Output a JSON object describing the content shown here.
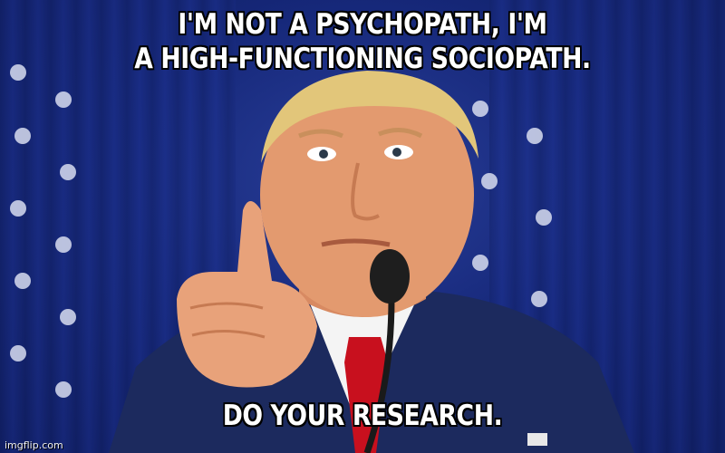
{
  "meme": {
    "top_text": {
      "line1": "I'M NOT A PSYCHOPATH, I'M",
      "line2": "A HIGH-FUNCTIONING SOCIOPATH."
    },
    "bottom_text": "DO YOUR RESEARCH.",
    "watermark": "imgflip.com"
  },
  "colors": {
    "backdrop": "#16287a",
    "caption_text": "#ffffff",
    "caption_outline": "#000000",
    "suit": "#1c2a5e",
    "tie": "#c8101e",
    "shirt": "#f4f4f4",
    "skin": "#e39a6f",
    "hair": "#e2c67a"
  }
}
